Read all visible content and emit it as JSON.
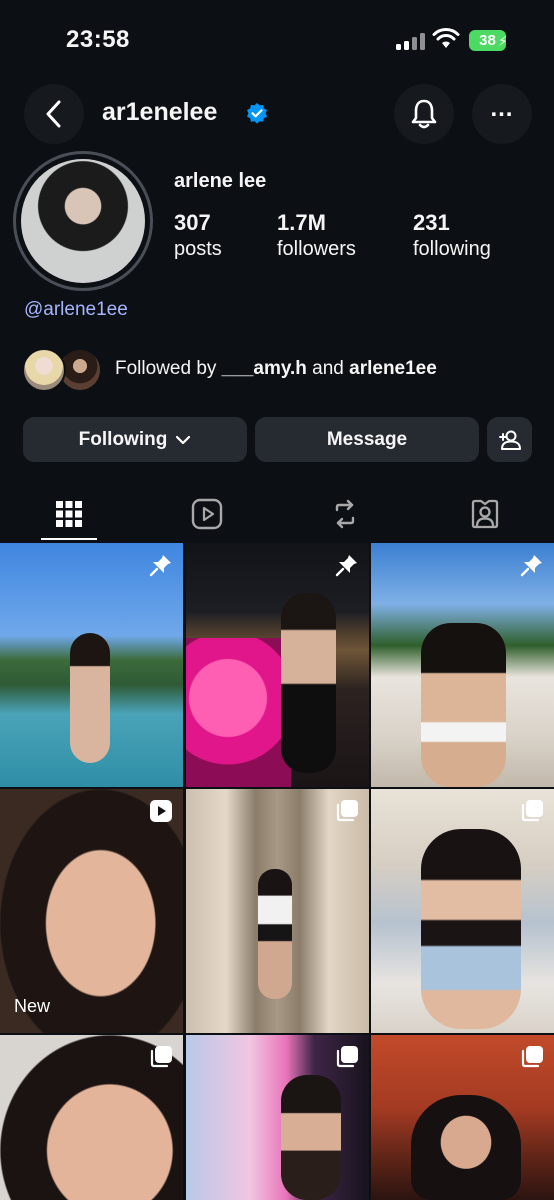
{
  "status_bar": {
    "time": "23:58",
    "battery": "38"
  },
  "header": {
    "handle": "ar1enelee",
    "icons": [
      "back-icon",
      "verified-icon",
      "bell-icon",
      "more-icon"
    ]
  },
  "profile": {
    "display_name": "arlene lee",
    "stats": [
      {
        "value": "307",
        "label": "posts"
      },
      {
        "value": "1.7M",
        "label": "followers"
      },
      {
        "value": "231",
        "label": "following"
      }
    ],
    "username_link": "@arlene1ee",
    "followed_by": {
      "prefix": "Followed by ",
      "user1": "___amy.h",
      "joiner": " and ",
      "user2": "arlene1ee"
    }
  },
  "actions": {
    "following_label": "Following",
    "message_label": "Message"
  },
  "tabs": [
    "grid-icon",
    "reels-icon",
    "reposts-icon",
    "tagged-icon"
  ],
  "posts": [
    {
      "badge": "pin-icon"
    },
    {
      "badge": "pin-icon"
    },
    {
      "badge": "pin-icon"
    },
    {
      "badge": "reel-icon",
      "label": "New"
    },
    {
      "badge": "carousel-icon"
    },
    {
      "badge": "carousel-icon"
    },
    {
      "badge": "carousel-icon"
    },
    {
      "badge": "carousel-icon"
    },
    {
      "badge": "carousel-icon"
    }
  ],
  "colors": {
    "background": "#0c1014",
    "button": "#262a31",
    "link": "#a7b5ff",
    "verified": "#0095f6",
    "battery": "#4cd964"
  }
}
